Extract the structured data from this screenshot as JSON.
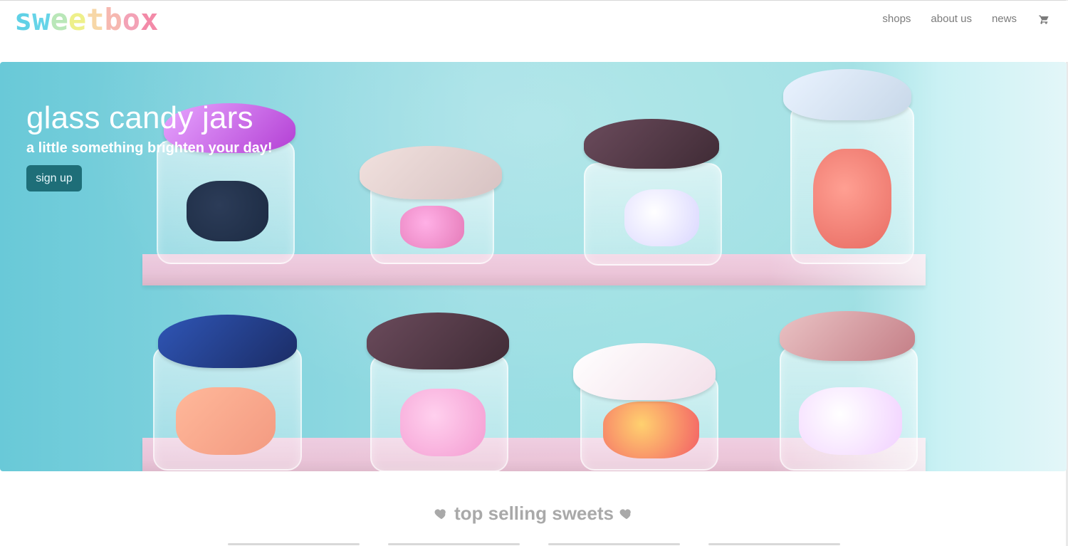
{
  "brand": {
    "logo_letters": [
      "s",
      "w",
      "e",
      "e",
      "t",
      "b",
      "o",
      "x"
    ],
    "logo_colors": [
      "#60d1e6",
      "#66d4e8",
      "#b9e7b8",
      "#eef08a",
      "#f7d7a7",
      "#f6b8b0",
      "#f3a2b6",
      "#f38aa8"
    ]
  },
  "nav": {
    "items": [
      {
        "label": "shops"
      },
      {
        "label": "about us"
      },
      {
        "label": "news"
      }
    ],
    "cart_icon": "cart-icon"
  },
  "hero": {
    "title": "glass candy jars",
    "subtitle": "a little something brighten your day!",
    "cta_label": "sign up",
    "colors": {
      "cta_bg": "#1e6e78"
    }
  },
  "section": {
    "title": "top selling sweets",
    "heart_icon": "heart-icon",
    "color": "#a9a9a9"
  }
}
